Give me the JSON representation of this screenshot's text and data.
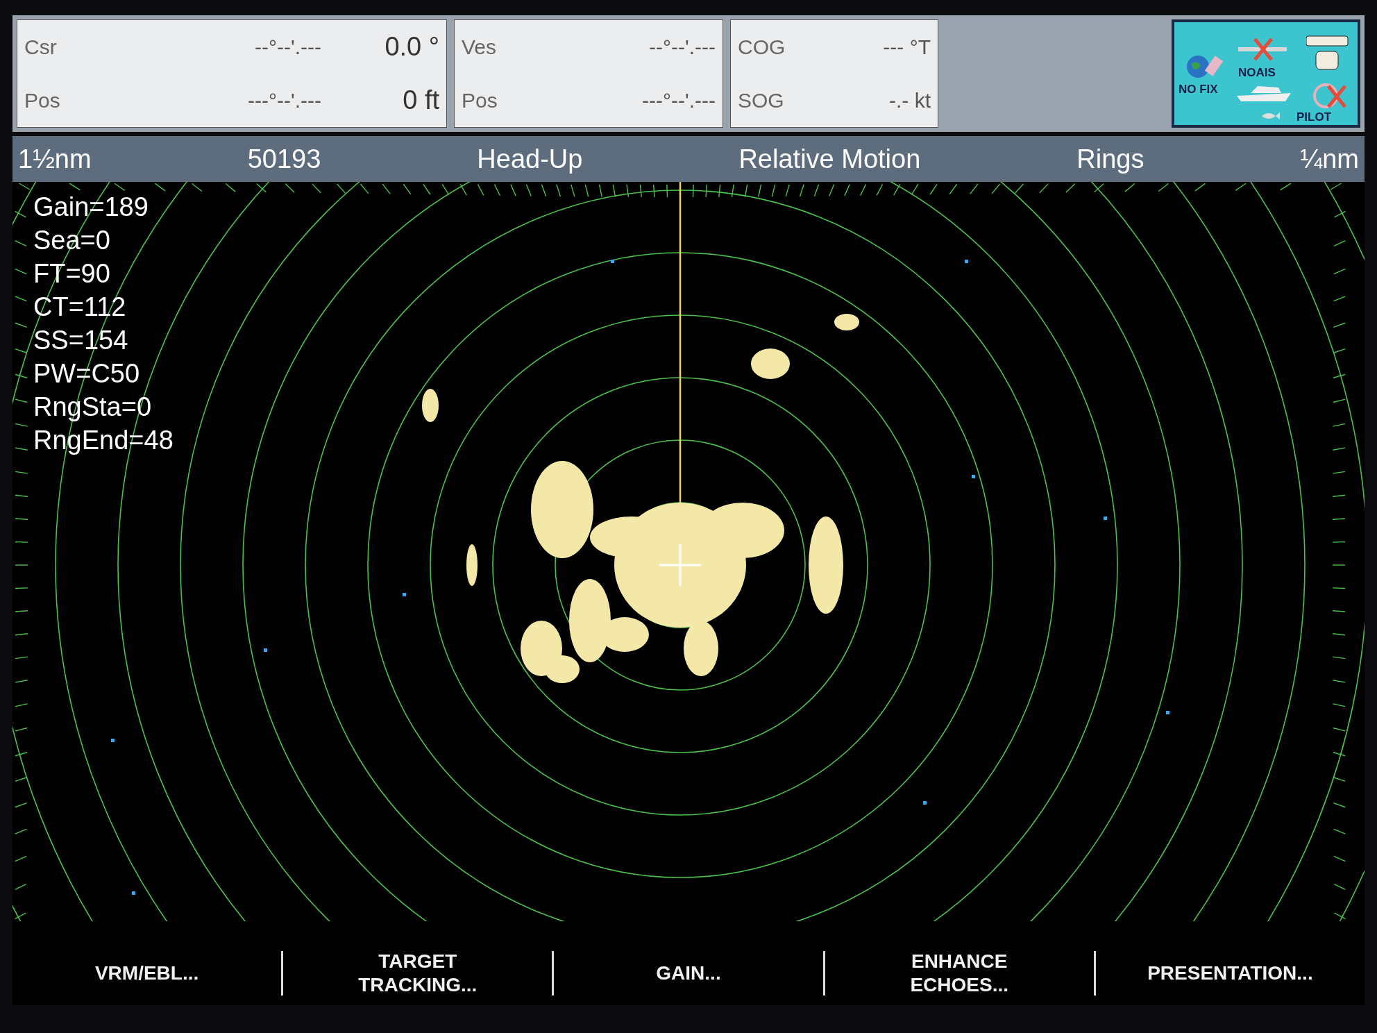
{
  "info_boxes": [
    {
      "rows": [
        {
          "label": "Csr",
          "value": "--°--'.---",
          "reading": "0.0 °"
        },
        {
          "label": "Pos",
          "value": "---°--'.---",
          "reading": "0 ft"
        }
      ]
    },
    {
      "rows": [
        {
          "label": "Ves",
          "value": "--°--'.---"
        },
        {
          "label": "Pos",
          "value": "---°--'.---"
        }
      ]
    },
    {
      "rows": [
        {
          "label": "COG",
          "value": "--- °T"
        },
        {
          "label": "SOG",
          "value": "-.- kt"
        }
      ]
    }
  ],
  "status_icons": {
    "no_fix": "NO FIX",
    "no_ais": "NOAIS",
    "pilot": "PILOT"
  },
  "status_bar": [
    "1½nm",
    "50193",
    "Head-Up",
    "Relative Motion",
    "Rings",
    "¼nm"
  ],
  "readouts": [
    "Gain=189",
    "Sea=0",
    "FT=90",
    "CT=112",
    "SS=154",
    "PW=C50",
    "RngSta=0",
    "RngEnd=48"
  ],
  "menu": [
    "VRM/EBL...",
    "TARGET\nTRACKING...",
    "GAIN...",
    "ENHANCE\nECHOES...",
    "PRESENTATION..."
  ]
}
